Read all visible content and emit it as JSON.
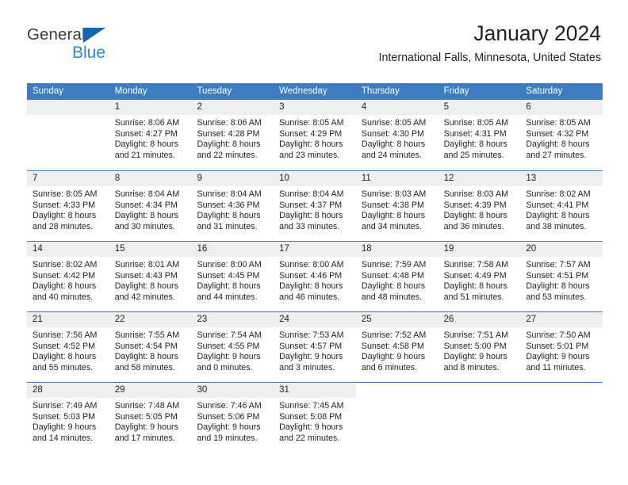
{
  "logo": {
    "word_top": "General",
    "word_bottom": "Blue",
    "triangle_color": "#1565b0",
    "blue_color": "#2a88d8"
  },
  "header": {
    "title": "January 2024",
    "subtitle": "International Falls, Minnesota, United States"
  },
  "theme": {
    "header_blue": "#3d7cbf",
    "daynum_gray": "#efefef",
    "text": "#231f20"
  },
  "weekdays": [
    "Sunday",
    "Monday",
    "Tuesday",
    "Wednesday",
    "Thursday",
    "Friday",
    "Saturday"
  ],
  "weeks": [
    [
      {
        "day": "",
        "lines": []
      },
      {
        "day": "1",
        "lines": [
          "Sunrise: 8:06 AM",
          "Sunset: 4:27 PM",
          "Daylight: 8 hours",
          "and 21 minutes."
        ]
      },
      {
        "day": "2",
        "lines": [
          "Sunrise: 8:06 AM",
          "Sunset: 4:28 PM",
          "Daylight: 8 hours",
          "and 22 minutes."
        ]
      },
      {
        "day": "3",
        "lines": [
          "Sunrise: 8:05 AM",
          "Sunset: 4:29 PM",
          "Daylight: 8 hours",
          "and 23 minutes."
        ]
      },
      {
        "day": "4",
        "lines": [
          "Sunrise: 8:05 AM",
          "Sunset: 4:30 PM",
          "Daylight: 8 hours",
          "and 24 minutes."
        ]
      },
      {
        "day": "5",
        "lines": [
          "Sunrise: 8:05 AM",
          "Sunset: 4:31 PM",
          "Daylight: 8 hours",
          "and 25 minutes."
        ]
      },
      {
        "day": "6",
        "lines": [
          "Sunrise: 8:05 AM",
          "Sunset: 4:32 PM",
          "Daylight: 8 hours",
          "and 27 minutes."
        ]
      }
    ],
    [
      {
        "day": "7",
        "lines": [
          "Sunrise: 8:05 AM",
          "Sunset: 4:33 PM",
          "Daylight: 8 hours",
          "and 28 minutes."
        ]
      },
      {
        "day": "8",
        "lines": [
          "Sunrise: 8:04 AM",
          "Sunset: 4:34 PM",
          "Daylight: 8 hours",
          "and 30 minutes."
        ]
      },
      {
        "day": "9",
        "lines": [
          "Sunrise: 8:04 AM",
          "Sunset: 4:36 PM",
          "Daylight: 8 hours",
          "and 31 minutes."
        ]
      },
      {
        "day": "10",
        "lines": [
          "Sunrise: 8:04 AM",
          "Sunset: 4:37 PM",
          "Daylight: 8 hours",
          "and 33 minutes."
        ]
      },
      {
        "day": "11",
        "lines": [
          "Sunrise: 8:03 AM",
          "Sunset: 4:38 PM",
          "Daylight: 8 hours",
          "and 34 minutes."
        ]
      },
      {
        "day": "12",
        "lines": [
          "Sunrise: 8:03 AM",
          "Sunset: 4:39 PM",
          "Daylight: 8 hours",
          "and 36 minutes."
        ]
      },
      {
        "day": "13",
        "lines": [
          "Sunrise: 8:02 AM",
          "Sunset: 4:41 PM",
          "Daylight: 8 hours",
          "and 38 minutes."
        ]
      }
    ],
    [
      {
        "day": "14",
        "lines": [
          "Sunrise: 8:02 AM",
          "Sunset: 4:42 PM",
          "Daylight: 8 hours",
          "and 40 minutes."
        ]
      },
      {
        "day": "15",
        "lines": [
          "Sunrise: 8:01 AM",
          "Sunset: 4:43 PM",
          "Daylight: 8 hours",
          "and 42 minutes."
        ]
      },
      {
        "day": "16",
        "lines": [
          "Sunrise: 8:00 AM",
          "Sunset: 4:45 PM",
          "Daylight: 8 hours",
          "and 44 minutes."
        ]
      },
      {
        "day": "17",
        "lines": [
          "Sunrise: 8:00 AM",
          "Sunset: 4:46 PM",
          "Daylight: 8 hours",
          "and 46 minutes."
        ]
      },
      {
        "day": "18",
        "lines": [
          "Sunrise: 7:59 AM",
          "Sunset: 4:48 PM",
          "Daylight: 8 hours",
          "and 48 minutes."
        ]
      },
      {
        "day": "19",
        "lines": [
          "Sunrise: 7:58 AM",
          "Sunset: 4:49 PM",
          "Daylight: 8 hours",
          "and 51 minutes."
        ]
      },
      {
        "day": "20",
        "lines": [
          "Sunrise: 7:57 AM",
          "Sunset: 4:51 PM",
          "Daylight: 8 hours",
          "and 53 minutes."
        ]
      }
    ],
    [
      {
        "day": "21",
        "lines": [
          "Sunrise: 7:56 AM",
          "Sunset: 4:52 PM",
          "Daylight: 8 hours",
          "and 55 minutes."
        ]
      },
      {
        "day": "22",
        "lines": [
          "Sunrise: 7:55 AM",
          "Sunset: 4:54 PM",
          "Daylight: 8 hours",
          "and 58 minutes."
        ]
      },
      {
        "day": "23",
        "lines": [
          "Sunrise: 7:54 AM",
          "Sunset: 4:55 PM",
          "Daylight: 9 hours",
          "and 0 minutes."
        ]
      },
      {
        "day": "24",
        "lines": [
          "Sunrise: 7:53 AM",
          "Sunset: 4:57 PM",
          "Daylight: 9 hours",
          "and 3 minutes."
        ]
      },
      {
        "day": "25",
        "lines": [
          "Sunrise: 7:52 AM",
          "Sunset: 4:58 PM",
          "Daylight: 9 hours",
          "and 6 minutes."
        ]
      },
      {
        "day": "26",
        "lines": [
          "Sunrise: 7:51 AM",
          "Sunset: 5:00 PM",
          "Daylight: 9 hours",
          "and 8 minutes."
        ]
      },
      {
        "day": "27",
        "lines": [
          "Sunrise: 7:50 AM",
          "Sunset: 5:01 PM",
          "Daylight: 9 hours",
          "and 11 minutes."
        ]
      }
    ],
    [
      {
        "day": "28",
        "lines": [
          "Sunrise: 7:49 AM",
          "Sunset: 5:03 PM",
          "Daylight: 9 hours",
          "and 14 minutes."
        ]
      },
      {
        "day": "29",
        "lines": [
          "Sunrise: 7:48 AM",
          "Sunset: 5:05 PM",
          "Daylight: 9 hours",
          "and 17 minutes."
        ]
      },
      {
        "day": "30",
        "lines": [
          "Sunrise: 7:46 AM",
          "Sunset: 5:06 PM",
          "Daylight: 9 hours",
          "and 19 minutes."
        ]
      },
      {
        "day": "31",
        "lines": [
          "Sunrise: 7:45 AM",
          "Sunset: 5:08 PM",
          "Daylight: 9 hours",
          "and 22 minutes."
        ]
      },
      {
        "day": "",
        "lines": []
      },
      {
        "day": "",
        "lines": []
      },
      {
        "day": "",
        "lines": []
      }
    ]
  ]
}
